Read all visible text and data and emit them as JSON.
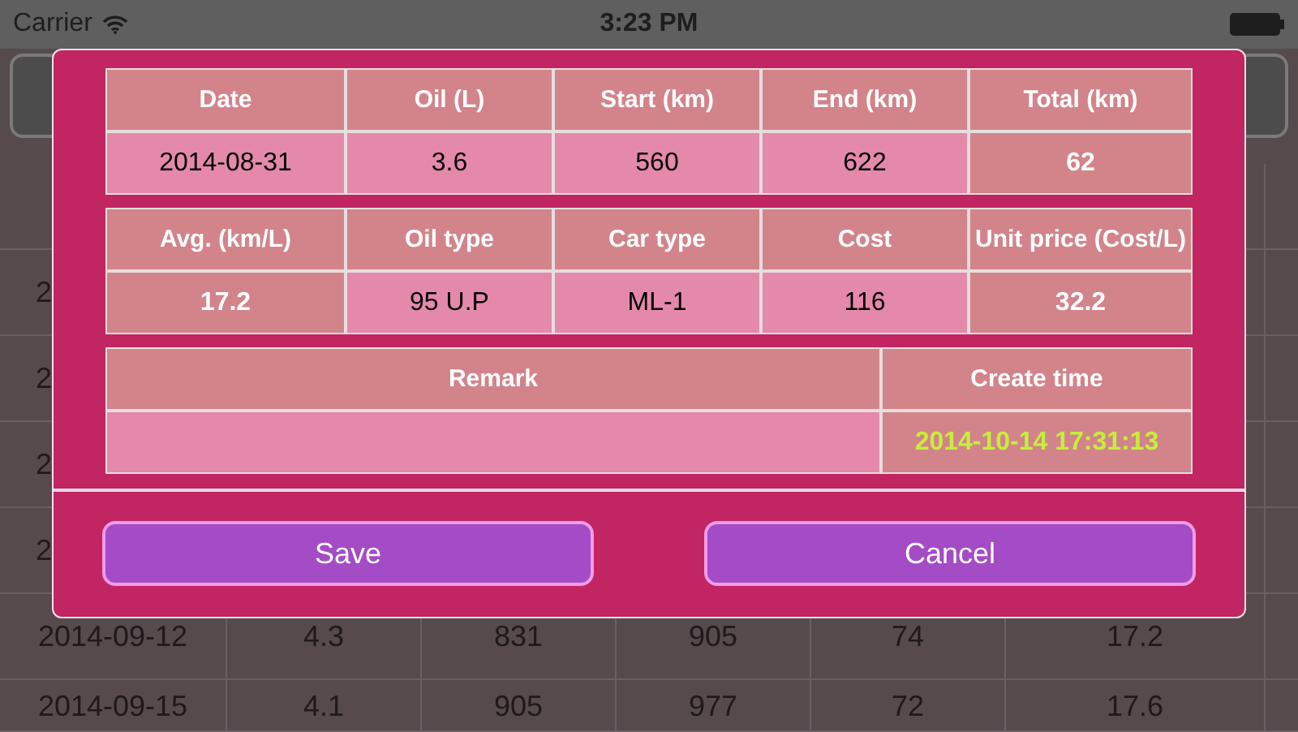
{
  "status_bar": {
    "carrier": "Carrier",
    "time": "3:23 PM"
  },
  "background_table": {
    "rows": [
      {
        "cells": []
      },
      {
        "cells": [
          "2"
        ]
      },
      {
        "cells": [
          "2"
        ]
      },
      {
        "cells": [
          "2"
        ]
      },
      {
        "cells": [
          "2"
        ]
      },
      {
        "cells": [
          "2014-09-12",
          "4.3",
          "831",
          "905",
          "74",
          "17.2"
        ]
      },
      {
        "cells": [
          "2014-09-15",
          "4.1",
          "905",
          "977",
          "72",
          "17.6"
        ]
      }
    ]
  },
  "dialog": {
    "tables": [
      {
        "columns": [
          "Date",
          "Oil (L)",
          "Start (km)",
          "End (km)",
          "Total (km)"
        ],
        "values": [
          {
            "text": "2014-08-31",
            "kind": "input"
          },
          {
            "text": "3.6",
            "kind": "input"
          },
          {
            "text": "560",
            "kind": "input"
          },
          {
            "text": "622",
            "kind": "input"
          },
          {
            "text": "62",
            "kind": "calc"
          }
        ]
      },
      {
        "columns": [
          "Avg. (km/L)",
          "Oil type",
          "Car type",
          "Cost",
          "Unit price (Cost/L)"
        ],
        "values": [
          {
            "text": "17.2",
            "kind": "calc"
          },
          {
            "text": "95 U.P",
            "kind": "input"
          },
          {
            "text": "ML-1",
            "kind": "input"
          },
          {
            "text": "116",
            "kind": "input"
          },
          {
            "text": "32.2",
            "kind": "calc"
          }
        ]
      },
      {
        "columns": [
          "Remark",
          "Create time"
        ],
        "values": [
          {
            "kind": "input"
          },
          {
            "text": "2014-10-14 17:31:13",
            "kind": "timestamp"
          }
        ]
      }
    ],
    "buttons": [
      "Save",
      "Cancel"
    ]
  }
}
